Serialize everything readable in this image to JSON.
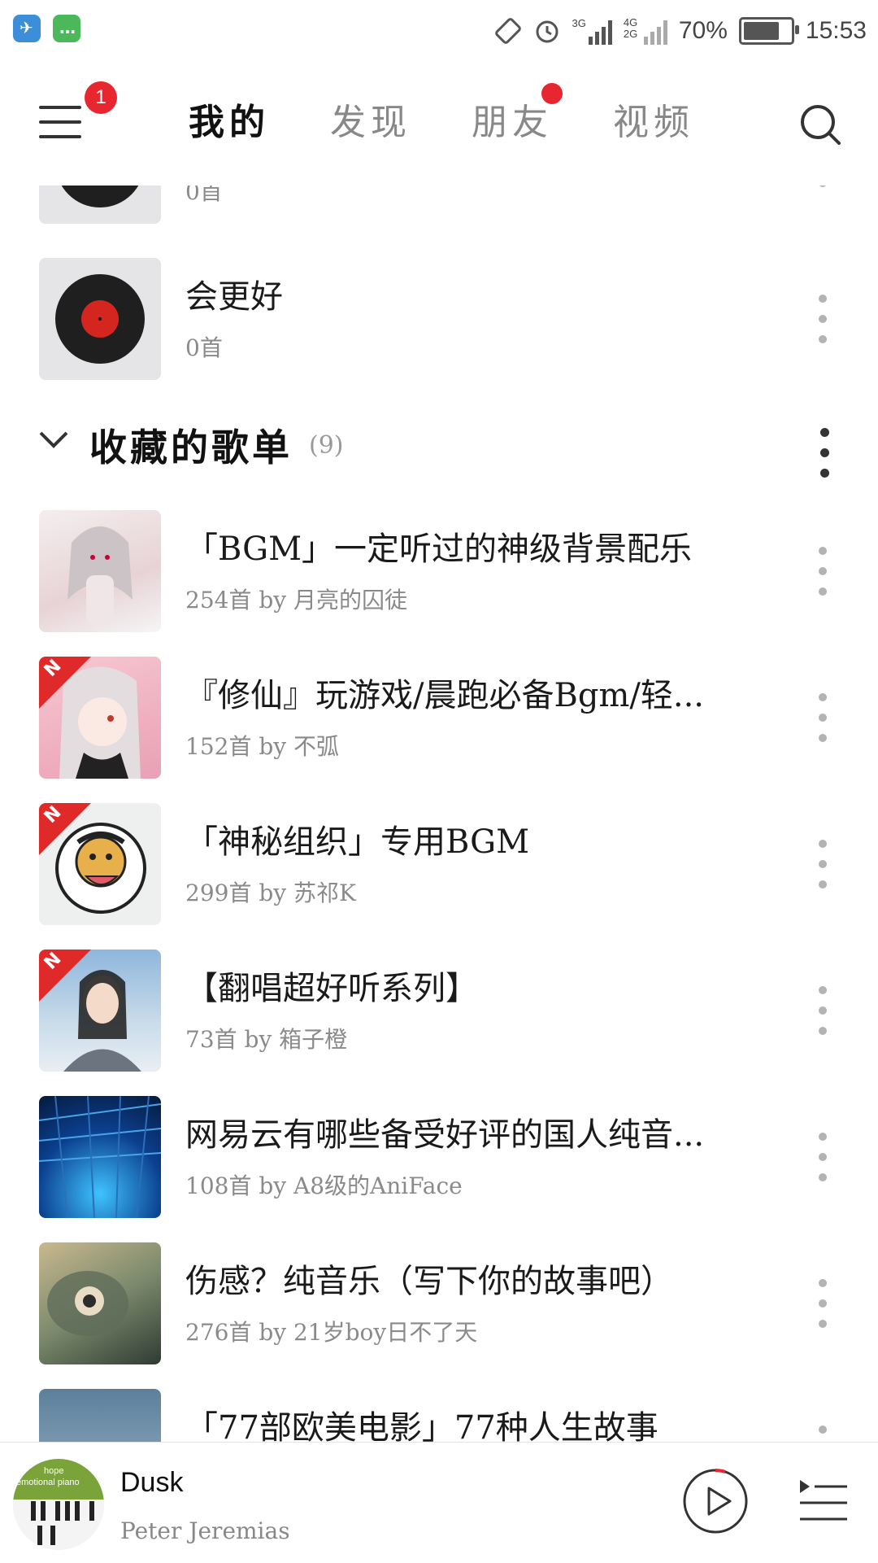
{
  "status_bar": {
    "battery": "70%",
    "time": "15:53",
    "network_1": "3G",
    "network_2": "4G 2G",
    "icons": [
      "bird-app-icon",
      "message-app-icon",
      "rotate-icon",
      "alarm-icon",
      "signal-icon",
      "battery-icon"
    ]
  },
  "nav": {
    "menu_badge": "1",
    "tabs": [
      {
        "label": "我的",
        "active": true
      },
      {
        "label": "发现",
        "active": false
      },
      {
        "label": "朋友",
        "active": false,
        "dot": true
      },
      {
        "label": "视频",
        "active": false
      }
    ]
  },
  "created_playlists": [
    {
      "title": "",
      "count": "0首"
    },
    {
      "title": "会更好",
      "count": "0首"
    }
  ],
  "collected_section": {
    "title": "收藏的歌单",
    "count": "(9)"
  },
  "collected_playlists": [
    {
      "title": "「BGM」一定听过的神级背景配乐",
      "sub": "254首 by 月亮的囚徒",
      "new": false
    },
    {
      "title": "『修仙』玩游戏/晨跑必备Bgm/轻...",
      "sub": "152首 by 不弧",
      "new": true
    },
    {
      "title": "「神秘组织」专用BGM",
      "sub": "299首 by 苏祁K",
      "new": true
    },
    {
      "title": "【翻唱超好听系列】",
      "sub": "73首 by 箱子橙",
      "new": true
    },
    {
      "title": "网易云有哪些备受好评的国人纯音...",
      "sub": "108首 by A8级的AniFace",
      "new": false
    },
    {
      "title": "伤感？纯音乐（写下你的故事吧）",
      "sub": "276首 by 21岁boy日不了天",
      "new": false
    },
    {
      "title": "「77部欧美电影」77种人生故事",
      "sub": "",
      "new": false
    }
  ],
  "new_badge_label": "N",
  "mini_player": {
    "cover_text_1": "hope",
    "cover_text_2": "emotional piano",
    "title": "Dusk",
    "artist": "Peter Jeremias"
  },
  "colors": {
    "accent": "#e8262f",
    "text": "#1a1a1a",
    "subtext": "#8a8a8a"
  }
}
